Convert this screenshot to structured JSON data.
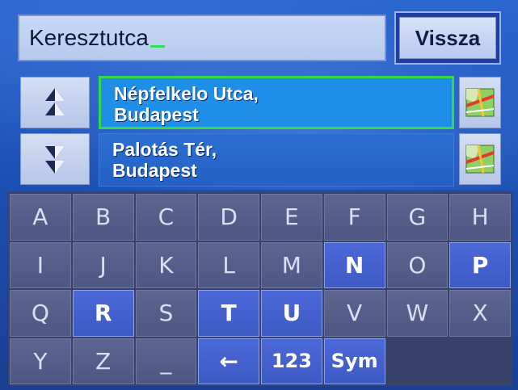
{
  "search": {
    "value": "Keresztutca"
  },
  "back_button": {
    "label": "Vissza"
  },
  "results": [
    {
      "line1": "Népfelkelo Utca,",
      "line2": "Budapest",
      "selected": true
    },
    {
      "line1": "Palotás Tér,",
      "line2": "Budapest",
      "selected": false
    }
  ],
  "icons": {
    "scroll_up": "double-up-arrow-icon",
    "scroll_down": "double-down-arrow-icon",
    "map": "map-icon"
  },
  "colors": {
    "selected_row": "#1e8ee6",
    "selected_border": "#35d84a",
    "key_active": "#4b69d8",
    "key_inactive": "#5c6690"
  },
  "keyboard": {
    "rows": [
      [
        {
          "label": "A",
          "active": false
        },
        {
          "label": "B",
          "active": false
        },
        {
          "label": "C",
          "active": false
        },
        {
          "label": "D",
          "active": false
        },
        {
          "label": "E",
          "active": false
        },
        {
          "label": "F",
          "active": false
        },
        {
          "label": "G",
          "active": false
        },
        {
          "label": "H",
          "active": false
        }
      ],
      [
        {
          "label": "I",
          "active": false
        },
        {
          "label": "J",
          "active": false
        },
        {
          "label": "K",
          "active": false
        },
        {
          "label": "L",
          "active": false
        },
        {
          "label": "M",
          "active": false
        },
        {
          "label": "N",
          "active": true
        },
        {
          "label": "O",
          "active": false
        },
        {
          "label": "P",
          "active": true
        }
      ],
      [
        {
          "label": "Q",
          "active": false
        },
        {
          "label": "R",
          "active": true
        },
        {
          "label": "S",
          "active": false
        },
        {
          "label": "T",
          "active": true
        },
        {
          "label": "U",
          "active": true
        },
        {
          "label": "V",
          "active": false
        },
        {
          "label": "W",
          "active": false
        },
        {
          "label": "X",
          "active": false
        }
      ],
      [
        {
          "label": "Y",
          "active": false
        },
        {
          "label": "Z",
          "active": false
        },
        {
          "label": "_",
          "active": false
        },
        {
          "label": "←",
          "active": true
        },
        {
          "label": "123",
          "active": true
        },
        {
          "label": "Sym",
          "active": true
        },
        {
          "label": "",
          "active": false
        },
        {
          "label": "",
          "active": false
        }
      ]
    ]
  }
}
